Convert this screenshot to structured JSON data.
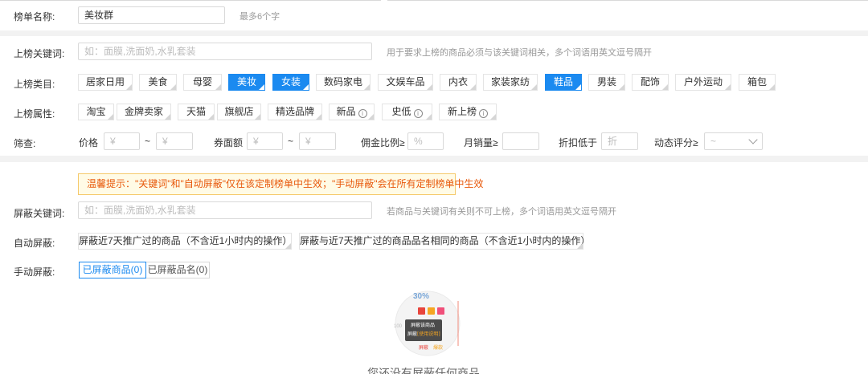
{
  "list_name": {
    "label": "榜单名称:",
    "value": "美妆群",
    "hint": "最多6个字"
  },
  "keyword": {
    "label": "上榜关键词:",
    "placeholder": "如：面膜,洗面奶,水乳套装",
    "hint": "用于要求上榜的商品必须与该关键词相关，多个词语用英文逗号隔开"
  },
  "category": {
    "label": "上榜类目:",
    "items": [
      {
        "label": "居家日用",
        "selected": false
      },
      {
        "label": "美食",
        "selected": false
      },
      {
        "label": "母婴",
        "selected": false
      },
      {
        "label": "美妆",
        "selected": true
      },
      {
        "label": "女装",
        "selected": true
      },
      {
        "label": "数码家电",
        "selected": false
      },
      {
        "label": "文娱车品",
        "selected": false
      },
      {
        "label": "内衣",
        "selected": false
      },
      {
        "label": "家装家纺",
        "selected": false
      },
      {
        "label": "鞋品",
        "selected": true
      },
      {
        "label": "男装",
        "selected": false
      },
      {
        "label": "配饰",
        "selected": false
      },
      {
        "label": "户外运动",
        "selected": false
      },
      {
        "label": "箱包",
        "selected": false
      }
    ]
  },
  "attributes": {
    "label": "上榜属性:",
    "items": [
      {
        "label": "淘宝",
        "info": false
      },
      {
        "label": "金牌卖家",
        "info": false
      },
      {
        "label": "天猫",
        "info": false
      },
      {
        "label": "旗舰店",
        "info": false
      },
      {
        "label": "精选品牌",
        "info": false
      },
      {
        "label": "新品",
        "info": true
      },
      {
        "label": "史低",
        "info": true
      },
      {
        "label": "新上榜",
        "info": true
      }
    ],
    "info_glyph": "i"
  },
  "filter": {
    "label": "筛查:",
    "price_label": "价格",
    "currency": "¥",
    "tilde": "~",
    "coupon_label": "券面额",
    "commission_label": "佣金比例≥",
    "percent": "%",
    "sales_label": "月销量≥",
    "discount_label": "折扣低于",
    "discount_placeholder": "折",
    "rating_label": "动态评分≥",
    "rating_value": "~"
  },
  "tip": "温馨提示：\"关键词\"和\"自动屏蔽\"仅在该定制榜单中生效；\"手动屏蔽\"会在所有定制榜单中生效",
  "block_keyword": {
    "label": "屏蔽关键词:",
    "placeholder": "如：面膜,洗面奶,水乳套装",
    "hint": "若商品与关键词有关则不可上榜，多个词语用英文逗号隔开"
  },
  "auto_block": {
    "label": "自动屏蔽:",
    "items": [
      "屏蔽近7天推广过的商品（不含近1小时内的操作）",
      "屏蔽与近7天推广过的商品品名相同的商品（不含近1小时内的操作）"
    ]
  },
  "manual_block": {
    "label": "手动屏蔽:",
    "tabs": [
      {
        "label": "已屏蔽商品(0)",
        "active": true
      },
      {
        "label": "已屏蔽品名(0)",
        "active": false
      }
    ]
  },
  "empty": {
    "illustration": {
      "percent": "30%",
      "tooltip_title": "屏蔽该商品",
      "tooltip_sub_prefix": "屏蔽",
      "tooltip_sub_link": "[使用说明]",
      "left_number": "100",
      "foot_1": "屏蔽",
      "foot_2": "爆款"
    },
    "message": "您还没有屏蔽任何商品"
  },
  "colors": {
    "accent": "#1b8af0",
    "tip_text": "#e8590c",
    "tip_bg": "#fffbe6",
    "band": "#f2f2f2"
  }
}
